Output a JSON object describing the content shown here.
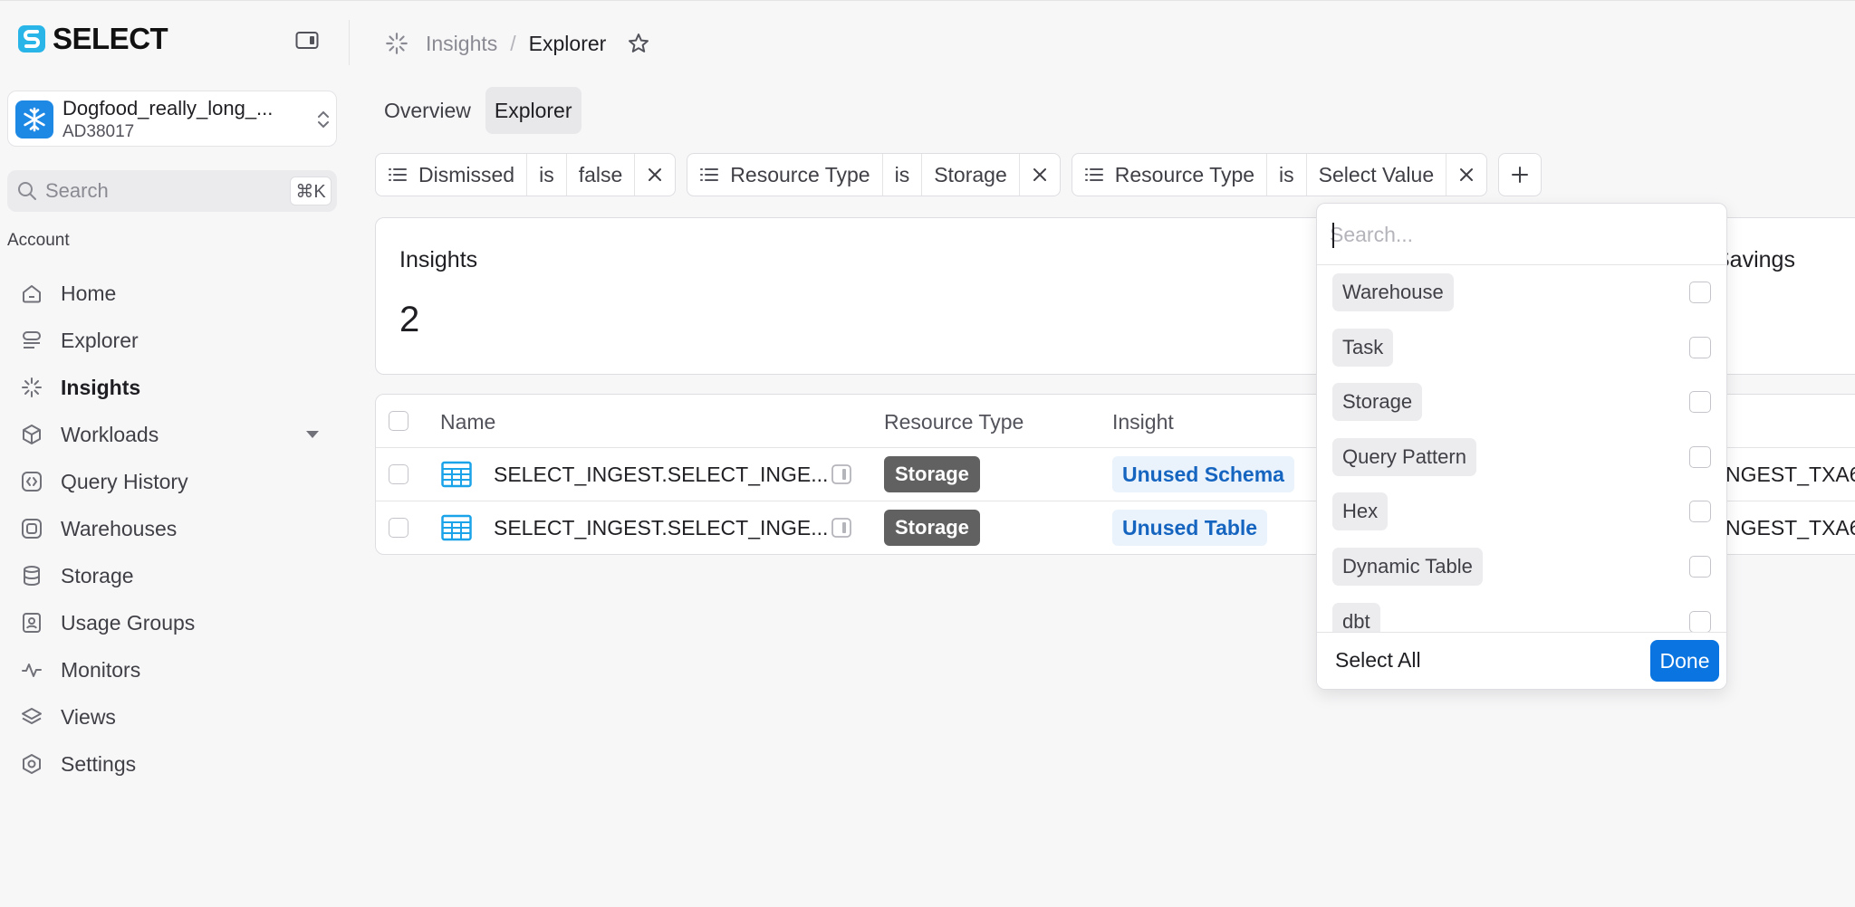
{
  "app": {
    "name": "SELECT"
  },
  "account": {
    "name": "Dogfood_really_long_...",
    "id": "AD38017"
  },
  "search": {
    "placeholder": "Search",
    "shortcut": "⌘K"
  },
  "sidebar": {
    "section_label": "Account",
    "items": [
      {
        "label": "Home",
        "icon": "home-icon"
      },
      {
        "label": "Explorer",
        "icon": "explorer-icon"
      },
      {
        "label": "Insights",
        "icon": "insights-icon",
        "active": true
      },
      {
        "label": "Workloads",
        "icon": "workloads-icon",
        "expandable": true
      },
      {
        "label": "Query History",
        "icon": "query-history-icon"
      },
      {
        "label": "Warehouses",
        "icon": "warehouses-icon"
      },
      {
        "label": "Storage",
        "icon": "storage-icon"
      },
      {
        "label": "Usage Groups",
        "icon": "usage-groups-icon"
      },
      {
        "label": "Monitors",
        "icon": "monitors-icon"
      },
      {
        "label": "Views",
        "icon": "views-icon"
      },
      {
        "label": "Settings",
        "icon": "settings-icon"
      }
    ]
  },
  "breadcrumb": {
    "parent": "Insights",
    "separator": "/",
    "current": "Explorer"
  },
  "tabs": [
    {
      "label": "Overview"
    },
    {
      "label": "Explorer",
      "active": true
    }
  ],
  "filters": [
    {
      "field": "Dismissed",
      "op": "is",
      "value": "false"
    },
    {
      "field": "Resource Type",
      "op": "is",
      "value": "Storage"
    },
    {
      "field": "Resource Type",
      "op": "is",
      "value": "Select Value"
    }
  ],
  "summary": {
    "insights_label": "Insights",
    "insights_count": "2",
    "savings_label": "Savings"
  },
  "table": {
    "columns": [
      "Name",
      "Resource Type",
      "Insight"
    ],
    "rows": [
      {
        "name": "SELECT_INGEST.SELECT_INGE...",
        "resource_type": "Storage",
        "insight": "Unused Schema",
        "trailing": "NGEST_TXA6"
      },
      {
        "name": "SELECT_INGEST.SELECT_INGE...",
        "resource_type": "Storage",
        "insight": "Unused Table",
        "trailing": "NGEST_TXA6"
      }
    ]
  },
  "dropdown": {
    "placeholder": "Search...",
    "options": [
      "Warehouse",
      "Task",
      "Storage",
      "Query Pattern",
      "Hex",
      "Dynamic Table",
      "dbt"
    ],
    "select_all": "Select All",
    "done": "Done"
  },
  "colors": {
    "accent": "#0a74e0",
    "brand": "#29b5e8",
    "badge_gray": "#616161",
    "insight_blue": "#1565c0"
  }
}
